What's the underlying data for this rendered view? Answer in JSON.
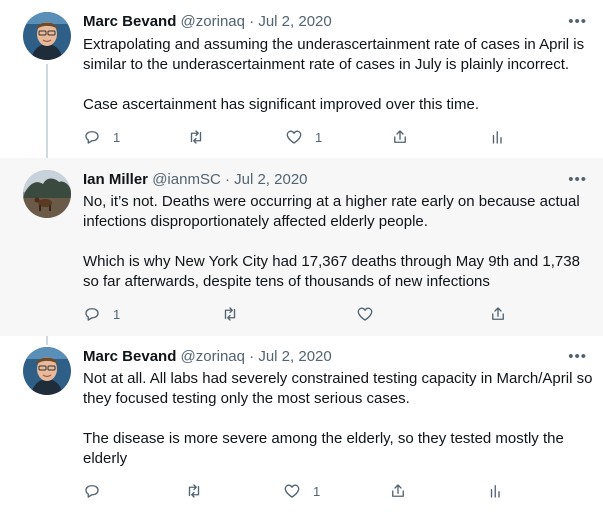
{
  "tweets": [
    {
      "author": "Marc Bevand",
      "handle": "@zorinaq",
      "separator": "·",
      "date": "Jul 2, 2020",
      "more": "•••",
      "paragraphs": [
        "Extrapolating and assuming the underascertainment rate of cases in April is similar to the underascertainment rate of cases in July is plainly incorrect.",
        "Case ascertainment has significant improved over this time."
      ],
      "reply_count": "1",
      "retweet_count": "",
      "like_count": "1"
    },
    {
      "author": "Ian Miller",
      "handle": "@ianmSC",
      "separator": "·",
      "date": "Jul 2, 2020",
      "more": "•••",
      "paragraphs": [
        "No, it’s not. Deaths were occurring at a higher rate early on because actual infections disproportionately affected elderly people.",
        "Which is why New York City had 17,367 deaths through May 9th and 1,738 so far afterwards, despite tens of thousands of new infections"
      ],
      "reply_count": "1",
      "retweet_count": "",
      "like_count": ""
    },
    {
      "author": "Marc Bevand",
      "handle": "@zorinaq",
      "separator": "·",
      "date": "Jul 2, 2020",
      "more": "•••",
      "paragraphs": [
        "Not at all. All labs had severely constrained testing capacity in March/April so they focused testing only the most serious cases.",
        "The disease is more severe among the elderly, so they tested mostly the elderly"
      ],
      "reply_count": "",
      "retweet_count": "",
      "like_count": "1"
    }
  ],
  "icons": {
    "reply": "reply-icon",
    "retweet": "retweet-icon",
    "like": "heart-icon",
    "share": "share-icon",
    "analytics": "analytics-icon"
  },
  "colors": {
    "icon_gray": "#536471",
    "highlight_bg": "#f7f7f7",
    "thread_line": "#cfd9de"
  }
}
